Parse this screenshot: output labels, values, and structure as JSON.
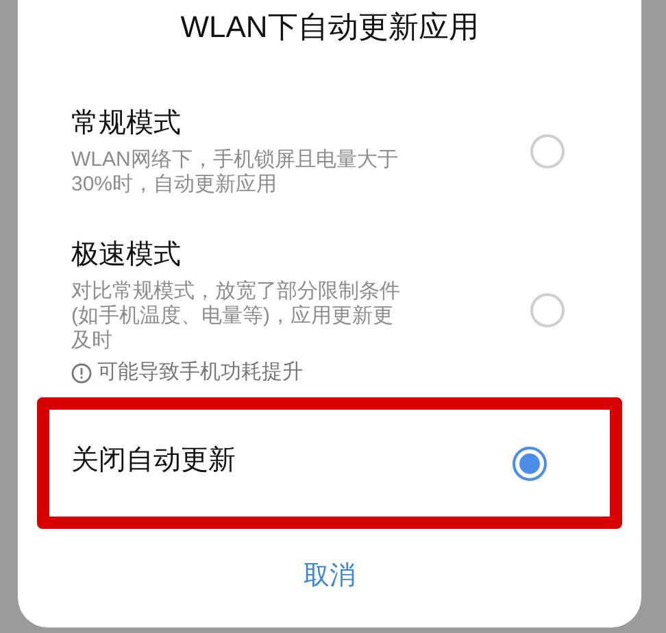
{
  "dialog": {
    "title": "WLAN下自动更新应用",
    "options": [
      {
        "label": "常规模式",
        "description": "WLAN网络下，手机锁屏且电量大于30%时，自动更新应用",
        "selected": false,
        "highlighted": false
      },
      {
        "label": "极速模式",
        "description": "对比常规模式，放宽了部分限制条件(如手机温度、电量等)，应用更新更及时",
        "warning": "可能导致手机功耗提升",
        "selected": false,
        "highlighted": false
      },
      {
        "label": "关闭自动更新",
        "selected": true,
        "highlighted": true
      }
    ],
    "cancel_button": "取消"
  }
}
